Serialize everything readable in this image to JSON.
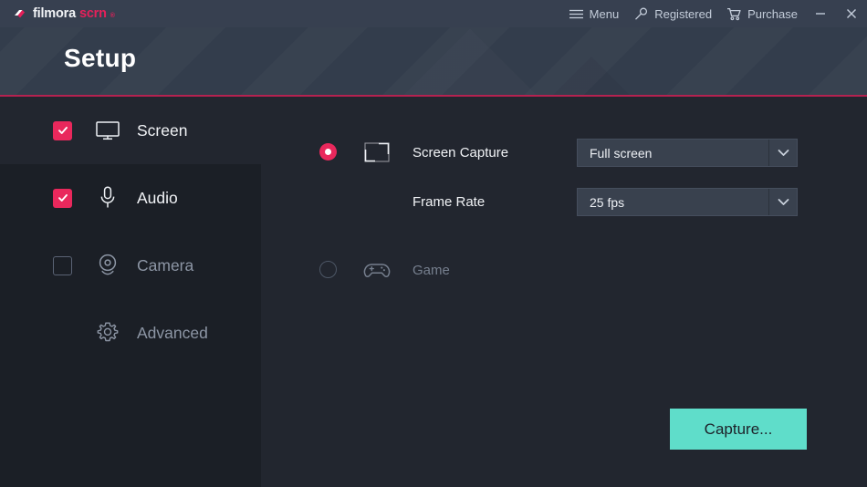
{
  "window": {
    "logo_primary": "filmora",
    "logo_secondary": "scrn",
    "logo_tm": "®",
    "logo_icon": "filmora-diamond-icon"
  },
  "titlebar": {
    "items": [
      {
        "label": "Menu",
        "icon": "hamburger-icon"
      },
      {
        "label": "Registered",
        "icon": "key-icon"
      },
      {
        "label": "Purchase",
        "icon": "cart-icon"
      }
    ],
    "minimize": "–",
    "close": "×"
  },
  "header": {
    "title": "Setup",
    "accent_color": "#b52250"
  },
  "sidebar": {
    "items": [
      {
        "label": "Screen",
        "icon": "monitor-icon",
        "checked": true,
        "enabled": true,
        "selected": true
      },
      {
        "label": "Audio",
        "icon": "microphone-icon",
        "checked": true,
        "enabled": true,
        "selected": false
      },
      {
        "label": "Camera",
        "icon": "webcam-icon",
        "checked": false,
        "enabled": false,
        "selected": false
      },
      {
        "label": "Advanced",
        "icon": "gear-icon",
        "checked": null,
        "enabled": false,
        "selected": false
      }
    ]
  },
  "main": {
    "options": [
      {
        "label": "Screen Capture",
        "icon": "screen-capture-icon",
        "selected": true
      },
      {
        "label": "Game",
        "icon": "gamepad-icon",
        "selected": false
      }
    ],
    "fields": [
      {
        "label": "Screen Capture",
        "value": "Full screen"
      },
      {
        "label": "Frame Rate",
        "value": "25 fps"
      }
    ],
    "capture_button": "Capture..."
  },
  "colors": {
    "accent_pink": "#e9285c",
    "accent_teal": "#5fddca",
    "header_bg": "#333d4c",
    "body_bg": "#22262f",
    "sidebar_bg": "#1b1f26"
  }
}
